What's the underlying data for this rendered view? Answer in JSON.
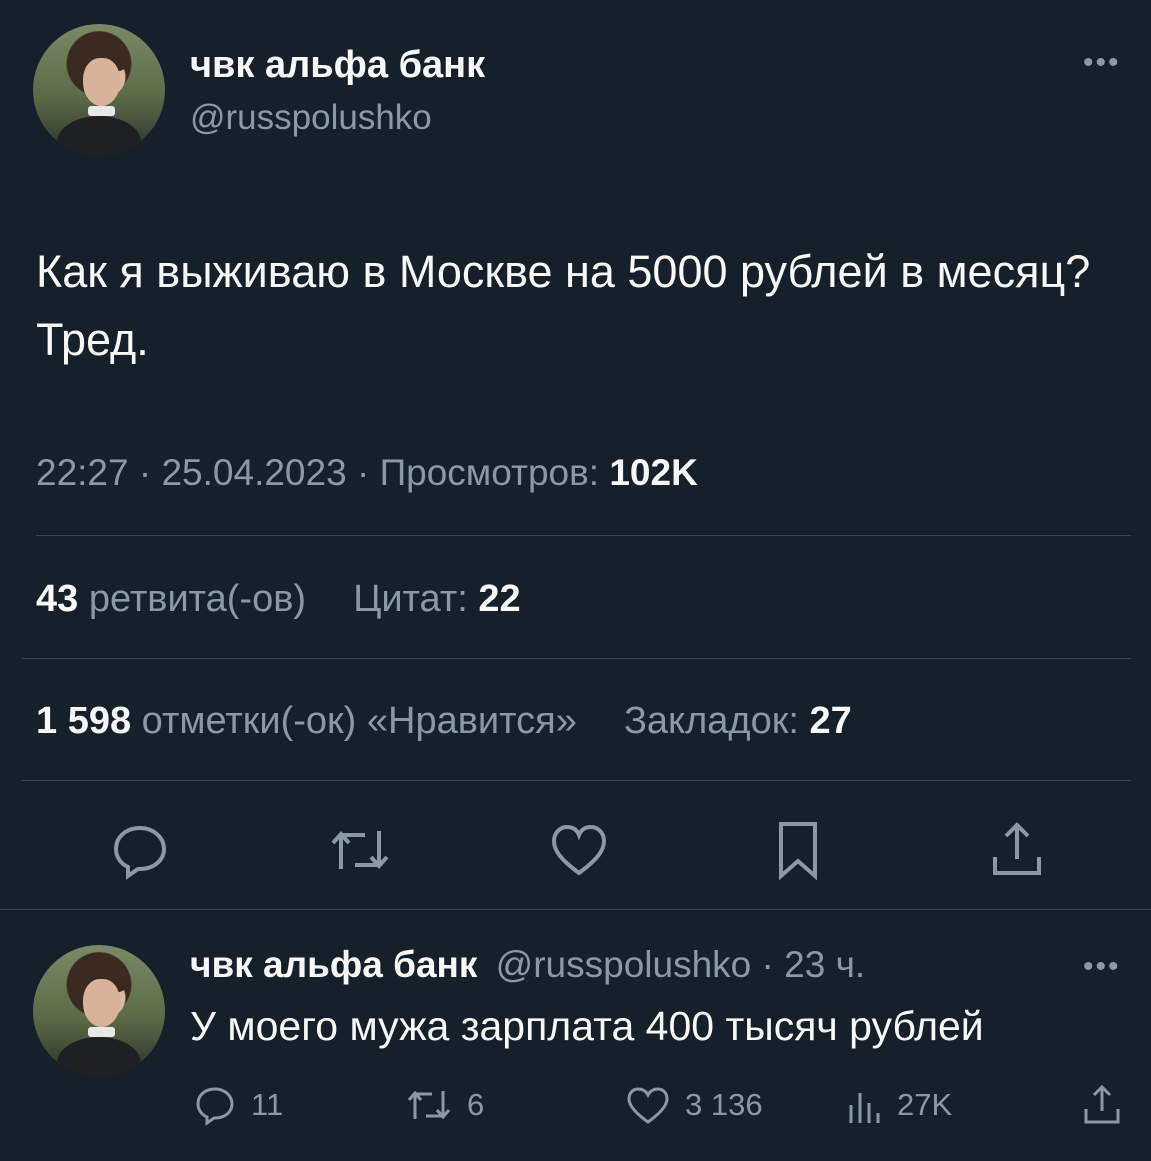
{
  "tweet": {
    "author_name": "чвк альфа банк",
    "author_handle": "@russpolushko",
    "text": "Как я выживаю в Москве на 5000 рублей в месяц? Тред.",
    "time": "22:27",
    "date": "25.04.2023",
    "views_label": "Просмотров:",
    "views_value": "102K",
    "retweets_value": "43",
    "retweets_label": "ретвита(-ов)",
    "quotes_label": "Цитат:",
    "quotes_value": "22",
    "likes_value": "1 598",
    "likes_label": "отметки(-ок) «Нравится»",
    "bookmarks_label": "Закладок:",
    "bookmarks_value": "27",
    "more_icon": "ellipsis-icon"
  },
  "reply": {
    "author_name": "чвк альфа банк",
    "author_handle": "@russpolushko",
    "time_ago": "23 ч.",
    "text": "У моего мужа зарплата 400 тысяч рублей",
    "replies_count": "11",
    "retweets_count": "6",
    "likes_count": "3 136",
    "views_count": "27K"
  },
  "colors": {
    "background": "#15202b",
    "text_primary": "#f7f9f9",
    "text_secondary": "#8b98a5",
    "divider": "#38444d"
  }
}
